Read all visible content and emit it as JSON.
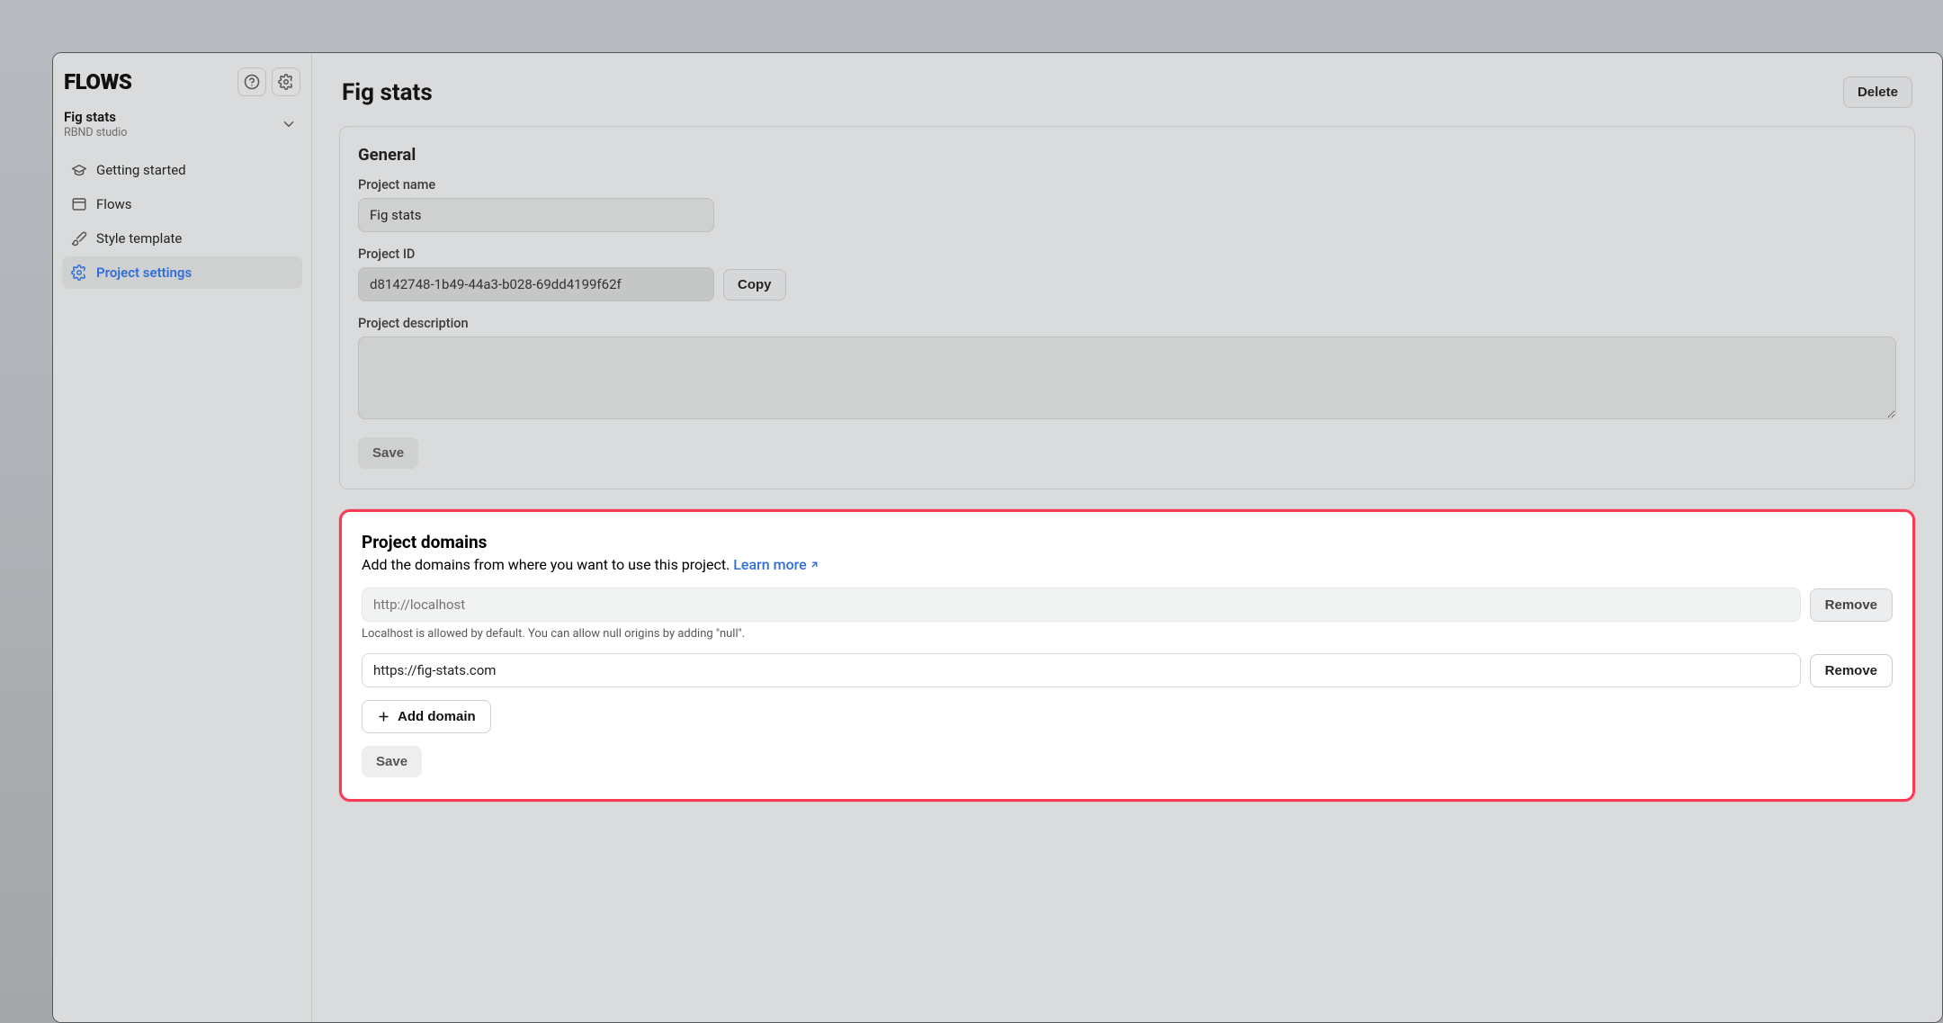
{
  "logo": "FLOWS",
  "sidebar": {
    "project_name": "Fig stats",
    "org_name": "RBND studio",
    "nav": [
      {
        "label": "Getting started"
      },
      {
        "label": "Flows"
      },
      {
        "label": "Style template"
      },
      {
        "label": "Project settings"
      }
    ]
  },
  "page": {
    "title": "Fig stats",
    "delete_label": "Delete"
  },
  "general": {
    "heading": "General",
    "name_label": "Project name",
    "name_value": "Fig stats",
    "id_label": "Project ID",
    "id_value": "d8142748-1b49-44a3-b028-69dd4199f62f",
    "copy_label": "Copy",
    "desc_label": "Project description",
    "desc_value": "",
    "save_label": "Save"
  },
  "domains": {
    "heading": "Project domains",
    "subtitle": "Add the domains from where you want to use this project.",
    "learn_more": "Learn more",
    "items": [
      {
        "value": "",
        "placeholder": "http://localhost",
        "remove_label": "Remove",
        "readonly": true
      },
      {
        "value": "https://fig-stats.com",
        "placeholder": "",
        "remove_label": "Remove",
        "readonly": false
      }
    ],
    "localhost_help": "Localhost is allowed by default. You can allow null origins by adding \"null\".",
    "add_label": "Add domain",
    "save_label": "Save"
  }
}
